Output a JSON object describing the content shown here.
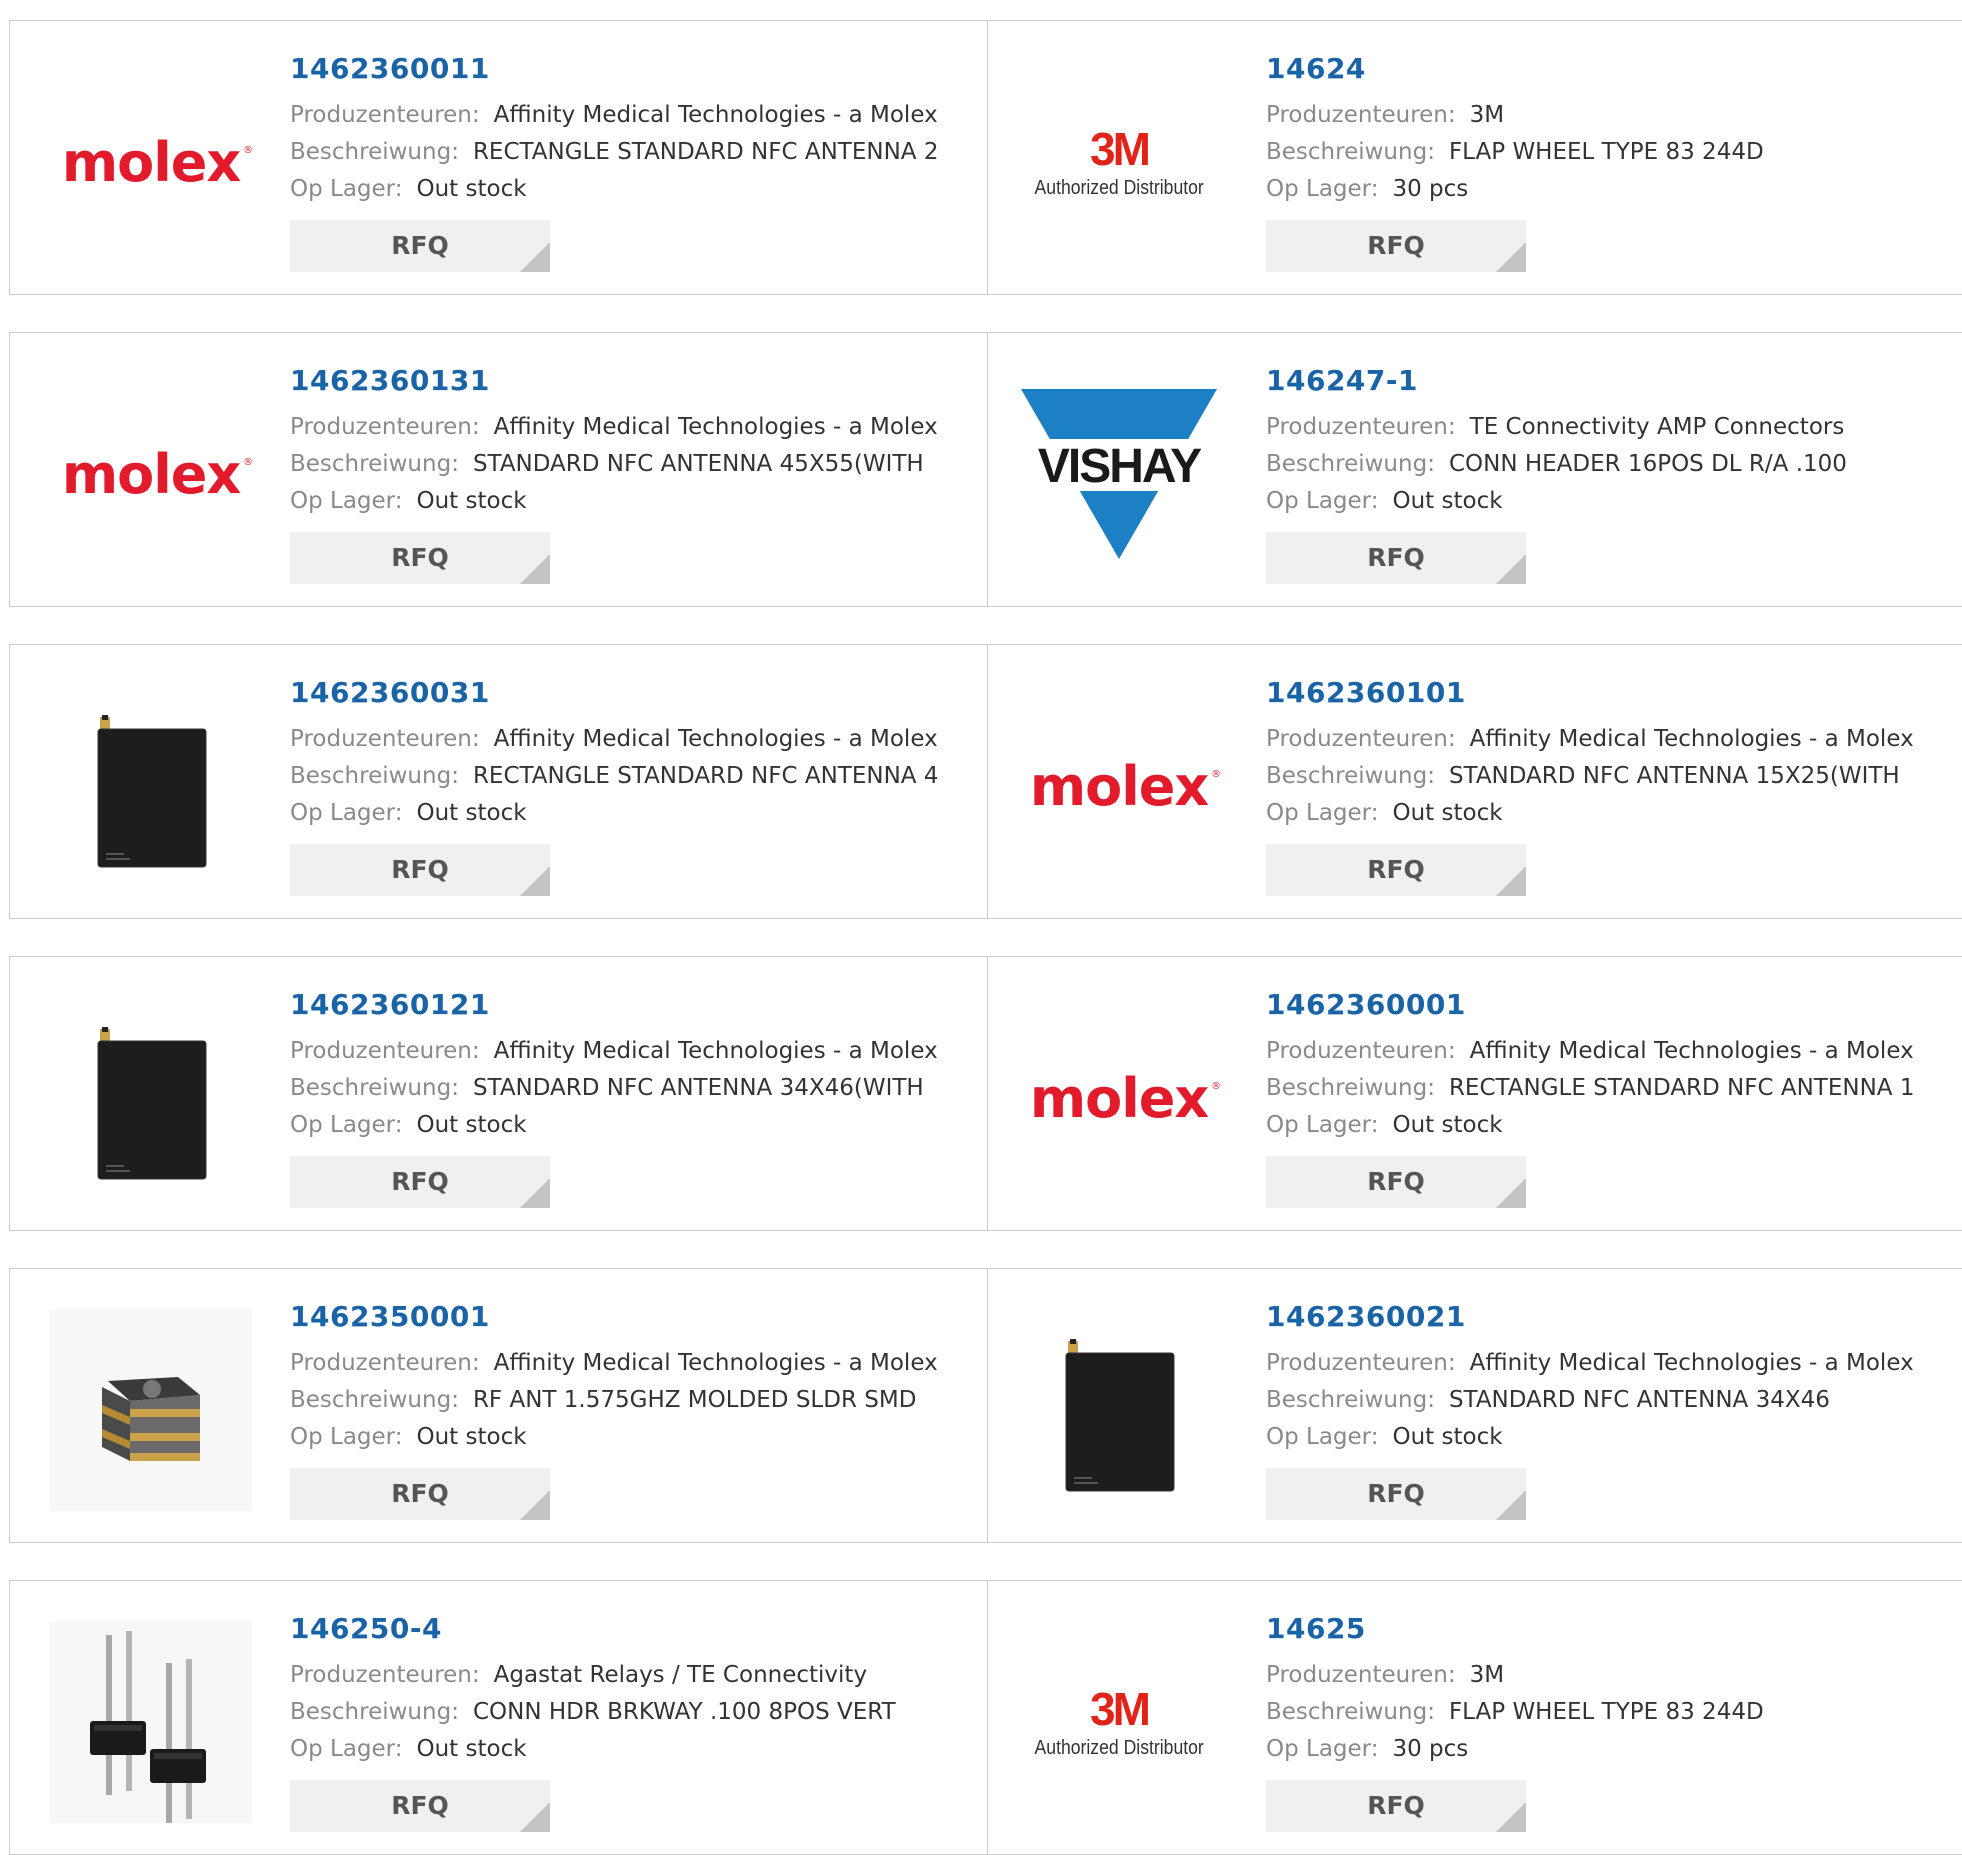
{
  "labels": {
    "manufacturer": "Produzenteuren:",
    "description": "Beschreiwung:",
    "stock": "Op Lager:",
    "rfq": "RFQ"
  },
  "logos": {
    "molex": "molex",
    "threem": "3M",
    "threem_sub": "Authorized Distributor",
    "vishay": "VISHAY"
  },
  "colors": {
    "part_link": "#1a63a6",
    "molex_red": "#e21b2c",
    "threem_red": "#e2231a",
    "vishay_blue": "#1d7fc4"
  },
  "rows": [
    {
      "left": {
        "part": "1462360011",
        "manufacturer": "Affinity Medical Technologies - a Molex",
        "description": "RECTANGLE STANDARD NFC ANTENNA 2",
        "stock": "Out stock",
        "image": "molex-logo"
      },
      "right": {
        "part": "14624",
        "manufacturer": "3M",
        "description": "FLAP WHEEL TYPE 83 244D",
        "stock": "30 pcs",
        "image": "3m-logo"
      }
    },
    {
      "left": {
        "part": "1462360131",
        "manufacturer": "Affinity Medical Technologies - a Molex",
        "description": "STANDARD NFC ANTENNA 45X55(WITH",
        "stock": "Out stock",
        "image": "molex-logo"
      },
      "right": {
        "part": "146247-1",
        "manufacturer": "TE Connectivity AMP Connectors",
        "description": "CONN HEADER 16POS DL R/A .100",
        "stock": "Out stock",
        "image": "vishay-logo"
      }
    },
    {
      "left": {
        "part": "1462360031",
        "manufacturer": "Affinity Medical Technologies - a Molex",
        "description": "RECTANGLE STANDARD NFC ANTENNA 4",
        "stock": "Out stock",
        "image": "nfc-antenna-photo"
      },
      "right": {
        "part": "1462360101",
        "manufacturer": "Affinity Medical Technologies - a Molex",
        "description": "STANDARD NFC ANTENNA 15X25(WITH",
        "stock": "Out stock",
        "image": "molex-logo"
      }
    },
    {
      "left": {
        "part": "1462360121",
        "manufacturer": "Affinity Medical Technologies - a Molex",
        "description": "STANDARD NFC ANTENNA 34X46(WITH",
        "stock": "Out stock",
        "image": "nfc-antenna-photo"
      },
      "right": {
        "part": "1462360001",
        "manufacturer": "Affinity Medical Technologies - a Molex",
        "description": "RECTANGLE STANDARD NFC ANTENNA 1",
        "stock": "Out stock",
        "image": "molex-logo"
      }
    },
    {
      "left": {
        "part": "1462350001",
        "manufacturer": "Affinity Medical Technologies - a Molex",
        "description": "RF ANT 1.575GHZ MOLDED SLDR SMD",
        "stock": "Out stock",
        "image": "smd-antenna-photo"
      },
      "right": {
        "part": "1462360021",
        "manufacturer": "Affinity Medical Technologies - a Molex",
        "description": "STANDARD NFC ANTENNA 34X46",
        "stock": "Out stock",
        "image": "nfc-antenna-photo"
      }
    },
    {
      "left": {
        "part": "146250-4",
        "manufacturer": "Agastat Relays / TE Connectivity",
        "description": "CONN HDR BRKWAY .100 8POS VERT",
        "stock": "Out stock",
        "image": "pin-header-photo"
      },
      "right": {
        "part": "14625",
        "manufacturer": "3M",
        "description": "FLAP WHEEL TYPE 83 244D",
        "stock": "30 pcs",
        "image": "3m-logo"
      }
    }
  ]
}
